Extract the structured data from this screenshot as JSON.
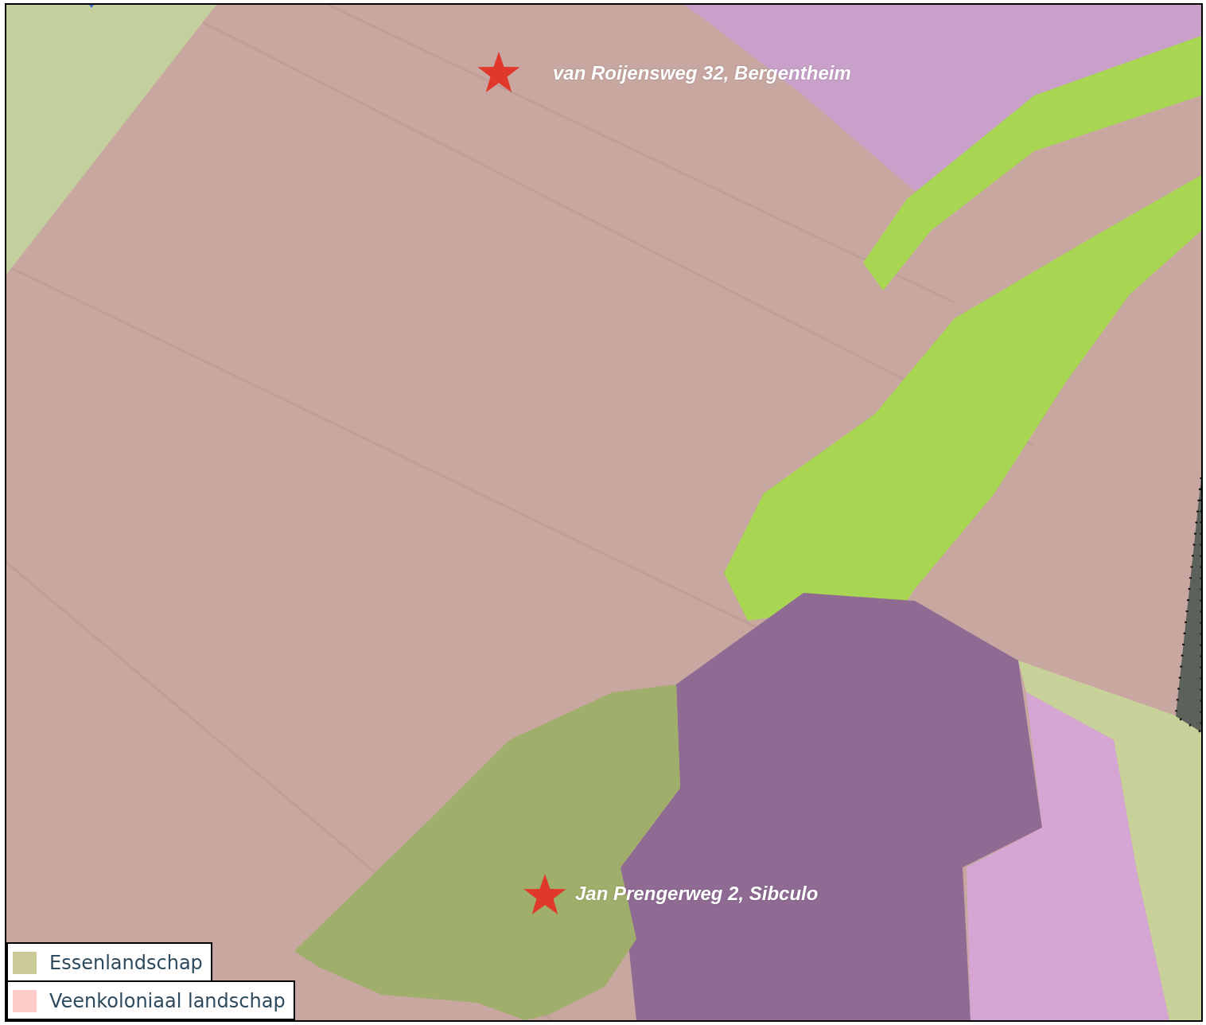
{
  "markers": [
    {
      "label": "van Roijensweg 32, Bergentheim"
    },
    {
      "label": "Jan Prengerweg 2, Sibculo"
    }
  ],
  "legend": [
    {
      "label": "Essenlandschap",
      "color": "#cbcb98"
    },
    {
      "label": "Veenkoloniaal landschap",
      "color": "#ffcaca"
    }
  ]
}
